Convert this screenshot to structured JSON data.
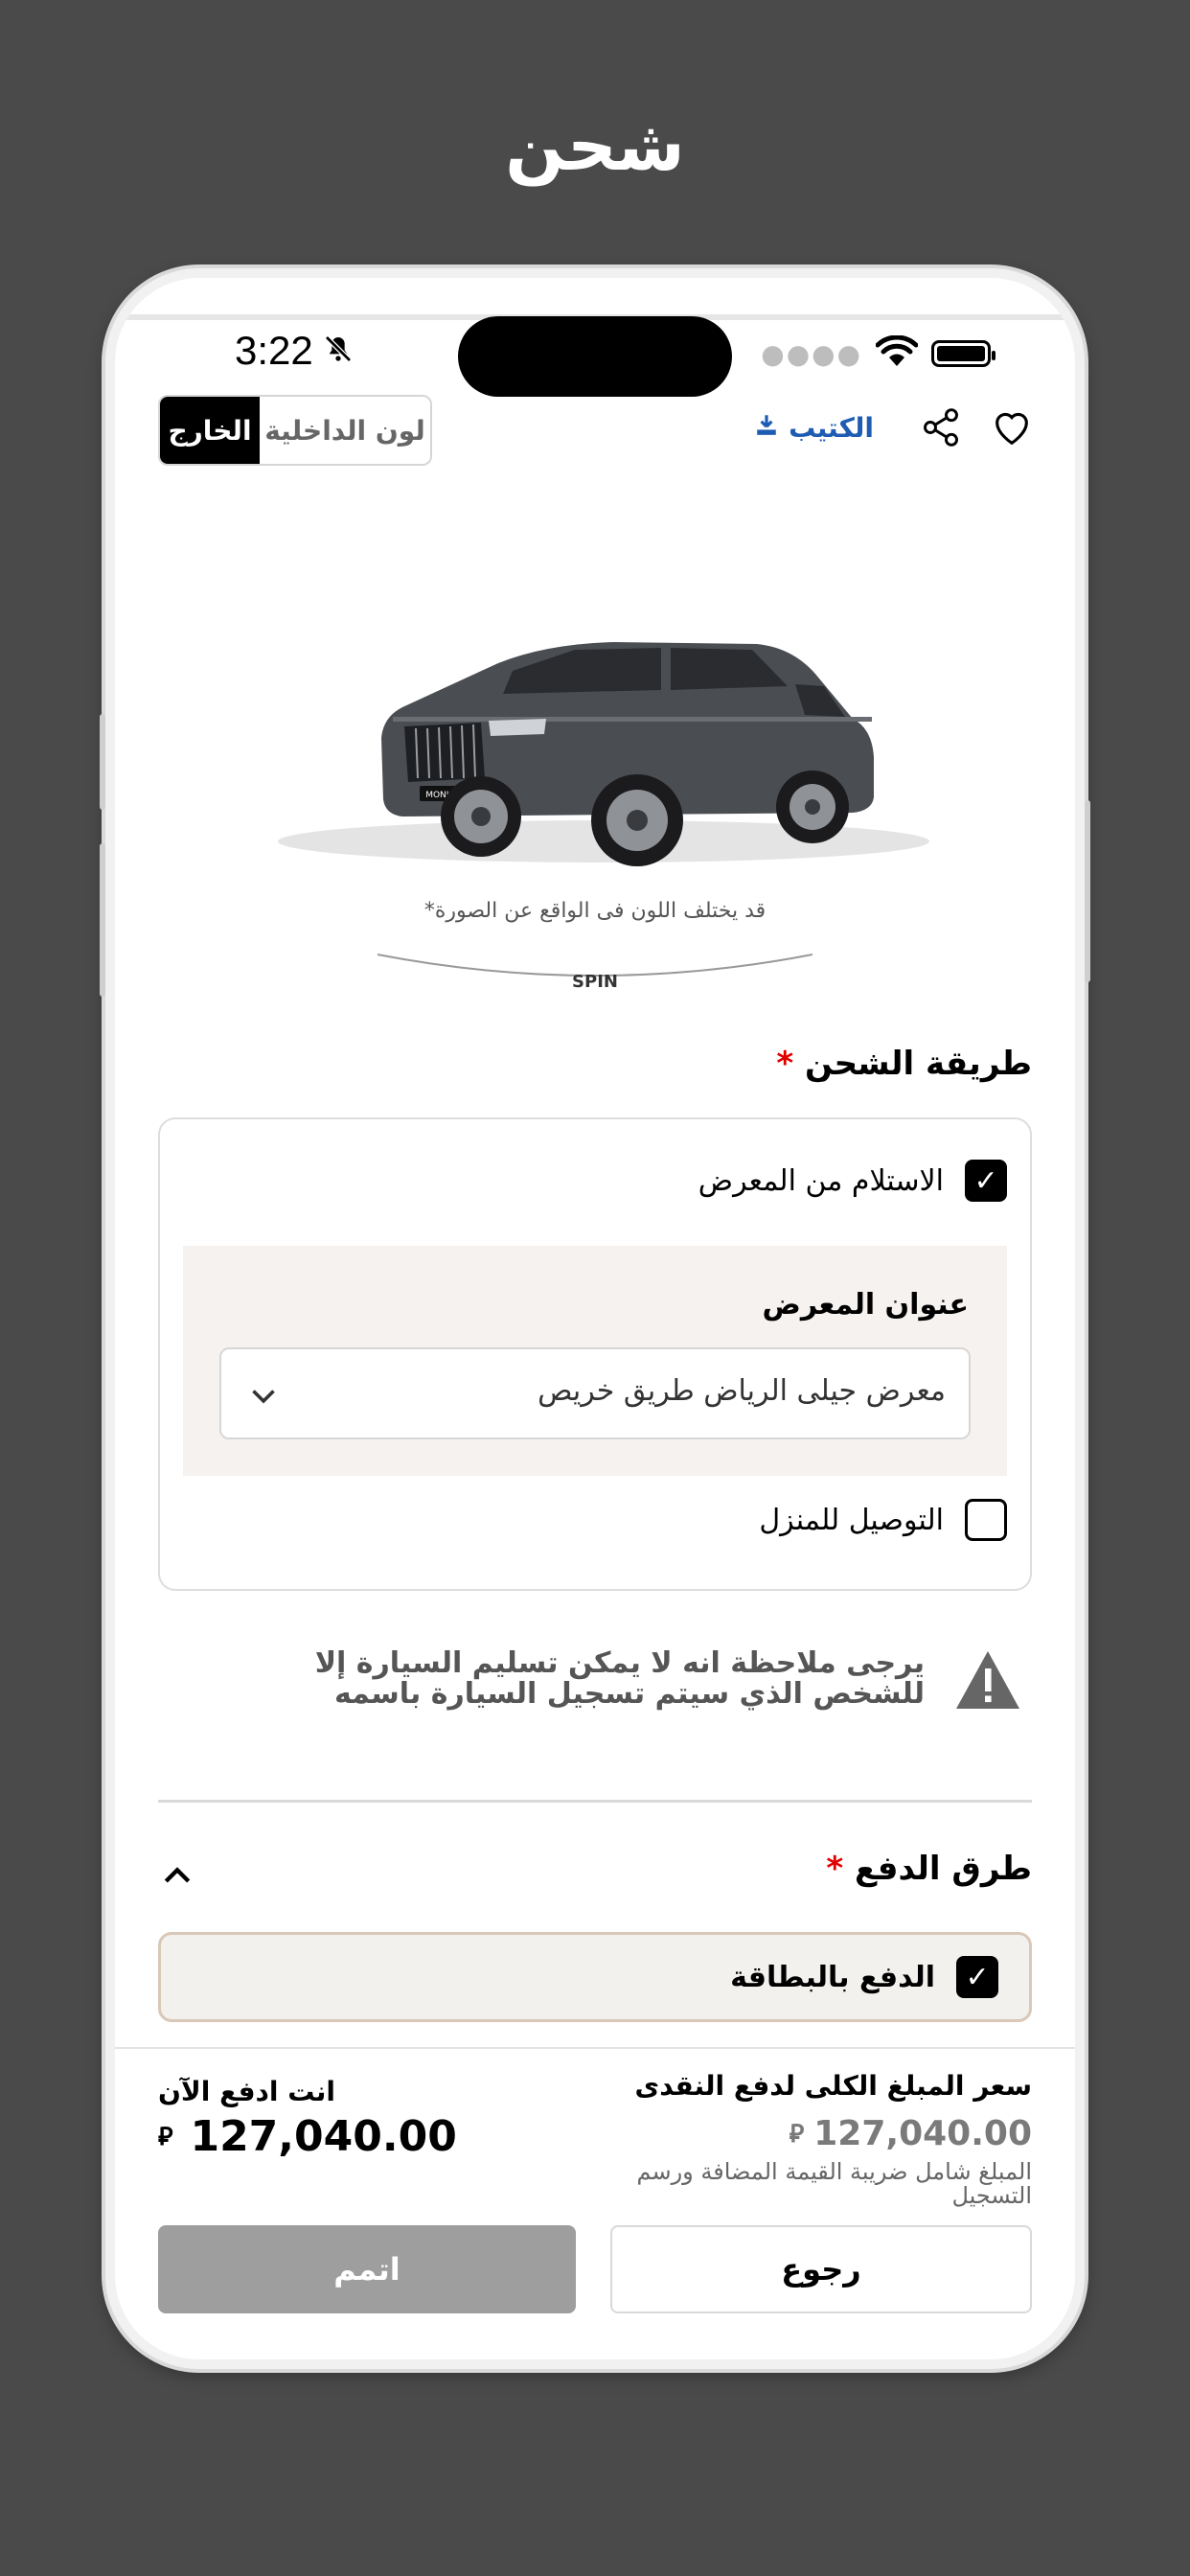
{
  "page": {
    "title": "شحن"
  },
  "status_bar": {
    "time": "3:22"
  },
  "header": {
    "toggle": {
      "interior": "لون الداخلية",
      "exterior": "الخارج"
    },
    "brochure": "الكتيب"
  },
  "vehicle": {
    "badge": "MONJARO",
    "disclaimer": "قد يختلف اللون فى الواقع عن الصورة*",
    "spin_label": "SPIN"
  },
  "shipping": {
    "title": "طريقة الشحن",
    "required_mark": "*",
    "pickup_label": "الاستلام من المعرض",
    "pickup_checked": true,
    "showroom_label": "عنوان المعرض",
    "showroom_value": "معرض جيلى الرياض طريق خريص",
    "home_delivery_label": "التوصيل للمنزل",
    "home_delivery_checked": false
  },
  "note": {
    "text": "يرجى ملاحظة انه لا يمكن تسليم السيارة إلا للشخص الذي سيتم تسجيل السيارة باسمه"
  },
  "payment": {
    "title": "طرق الدفع",
    "required_mark": "*",
    "card_label": "الدفع بالبطاقة",
    "card_checked": true
  },
  "footer": {
    "total_label": "سعر المبلغ الكلى لدفع النقدى",
    "total_value": "127,040.00",
    "total_note": "المبلغ شامل ضريبة القيمة المضافة ورسم التسجيل",
    "pay_now_label": "انت ادفع الآن",
    "pay_now_value": "127,040.00",
    "currency_symbol": "⃁",
    "back_button": "رجوع",
    "done_button": "اتمم"
  },
  "colors": {
    "accent_blue": "#1e5cb3",
    "required_red": "#e00000",
    "disabled_button": "#9e9e9e",
    "panel_bg": "#f5f2ef"
  }
}
